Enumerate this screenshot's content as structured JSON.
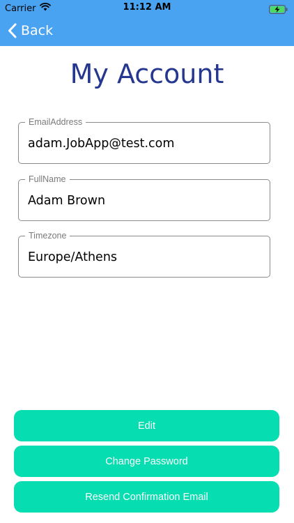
{
  "status_bar": {
    "carrier": "Carrier",
    "time": "11:12 AM"
  },
  "nav": {
    "back_label": "Back"
  },
  "page": {
    "title": "My Account"
  },
  "fields": {
    "email": {
      "label": "EmailAddress",
      "value": "adam.JobApp@test.com"
    },
    "fullname": {
      "label": "FullName",
      "value": "Adam Brown"
    },
    "timezone": {
      "label": "Timezone",
      "value": "Europe/Athens"
    }
  },
  "buttons": {
    "edit": "Edit",
    "change_password": "Change Password",
    "resend": "Resend Confirmation Email"
  },
  "colors": {
    "nav_background": "#4aa3f0",
    "title": "#26378f",
    "button": "#06ddb0",
    "battery_fill": "#4cd964"
  },
  "icons": {
    "wifi": "wifi-icon",
    "battery": "battery-charging-icon",
    "back": "chevron-left-icon"
  }
}
